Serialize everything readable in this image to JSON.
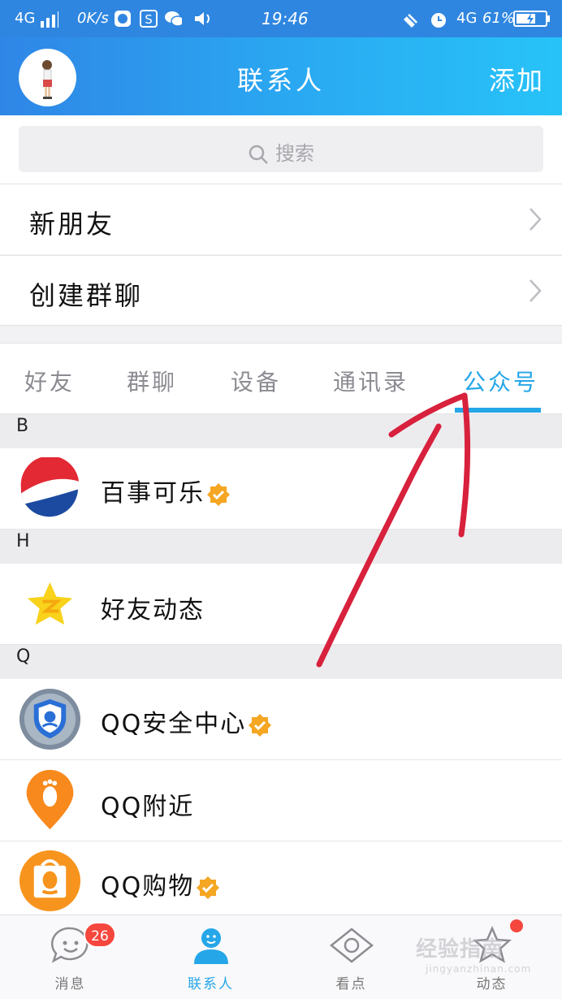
{
  "status_bar": {
    "network_left": "4G",
    "speed": "0K/s",
    "time": "19:46",
    "network_right": "4G",
    "battery": "61%"
  },
  "header": {
    "title": "联系人",
    "add_label": "添加"
  },
  "search": {
    "placeholder": "搜索"
  },
  "menu": {
    "new_friends": "新朋友",
    "create_group": "创建群聊"
  },
  "tabs": [
    {
      "label": "好友",
      "active": false
    },
    {
      "label": "群聊",
      "active": false
    },
    {
      "label": "设备",
      "active": false
    },
    {
      "label": "通讯录",
      "active": false
    },
    {
      "label": "公众号",
      "active": true
    }
  ],
  "sections": [
    {
      "letter": "B",
      "items": [
        {
          "name": "百事可乐",
          "verified": true,
          "icon": "pepsi-logo"
        }
      ]
    },
    {
      "letter": "H",
      "items": [
        {
          "name": "好友动态",
          "verified": false,
          "icon": "qzone-star-logo"
        }
      ]
    },
    {
      "letter": "Q",
      "items": [
        {
          "name": "QQ安全中心",
          "verified": true,
          "icon": "qq-security-shield-logo"
        },
        {
          "name": "QQ附近",
          "verified": false,
          "icon": "qq-nearby-footprint-logo"
        },
        {
          "name": "QQ购物",
          "verified": true,
          "icon": "qq-shopping-bag-logo"
        }
      ]
    }
  ],
  "bottom_nav": [
    {
      "label": "消息",
      "badge": "26",
      "active": false,
      "icon": "chat-bubble-icon"
    },
    {
      "label": "联系人",
      "active": true,
      "icon": "contacts-person-icon"
    },
    {
      "label": "看点",
      "active": false,
      "icon": "eye-icon"
    },
    {
      "label": "动态",
      "active": false,
      "icon": "star-icon"
    }
  ],
  "watermark": {
    "text": "经验指南",
    "subtext": "jingyanzhinan.com"
  },
  "colors": {
    "accent": "#25a6e8",
    "header_start": "#2f86e6",
    "header_end": "#27c3f8",
    "badge": "#f5473e",
    "annotation_arrow": "#d8213c",
    "verified": "#f5a623"
  }
}
